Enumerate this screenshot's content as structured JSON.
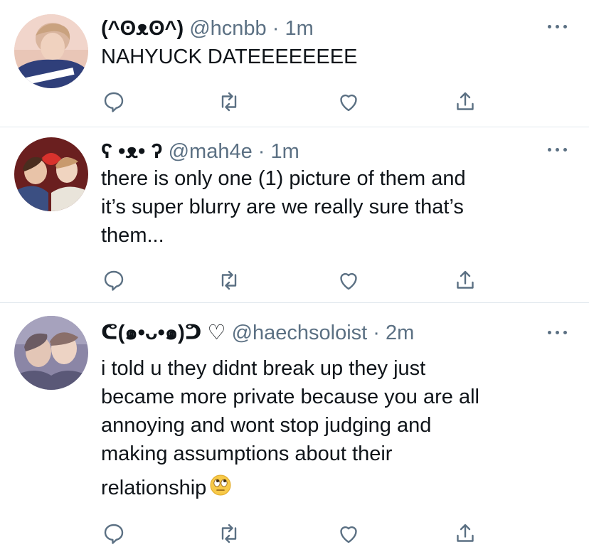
{
  "colors": {
    "text": "#0f1419",
    "secondary": "#5b7083",
    "divider": "#e1e8ed",
    "background": "#ffffff"
  },
  "tweets": [
    {
      "display_name": "(^ʘᴥʘ^)",
      "handle": "@hcnbb",
      "separator": "·",
      "time": "1m",
      "text_lines": [
        "NAHYUCK DATEEEEEEEE"
      ],
      "avatar_icon": "profile-photo",
      "actions": [
        "reply-icon",
        "retweet-icon",
        "like-icon",
        "share-icon"
      ]
    },
    {
      "display_name": "ʕ •ᴥ• ʔ",
      "handle": "@mah4e",
      "separator": "·",
      "time": "1m",
      "text_lines": [
        "there is only one (1) picture of them and",
        "it’s super blurry are we really sure that’s",
        "them..."
      ],
      "avatar_icon": "profile-photo",
      "actions": [
        "reply-icon",
        "retweet-icon",
        "like-icon",
        "share-icon"
      ]
    },
    {
      "display_name": "ᕦ(๑•ᴗ•๑)ᕤ ♡",
      "handle": "@haechsoloist",
      "separator": "·",
      "time": "2m",
      "text_lines": [
        "i told u they didnt break up they just",
        "became more private because you are all",
        "annoying and wont stop judging and",
        "making assumptions about their",
        "relationship"
      ],
      "trailing_emoji": "eye-roll-emoji",
      "avatar_icon": "profile-photo",
      "actions": [
        "reply-icon",
        "retweet-icon",
        "like-icon",
        "share-icon"
      ]
    }
  ]
}
